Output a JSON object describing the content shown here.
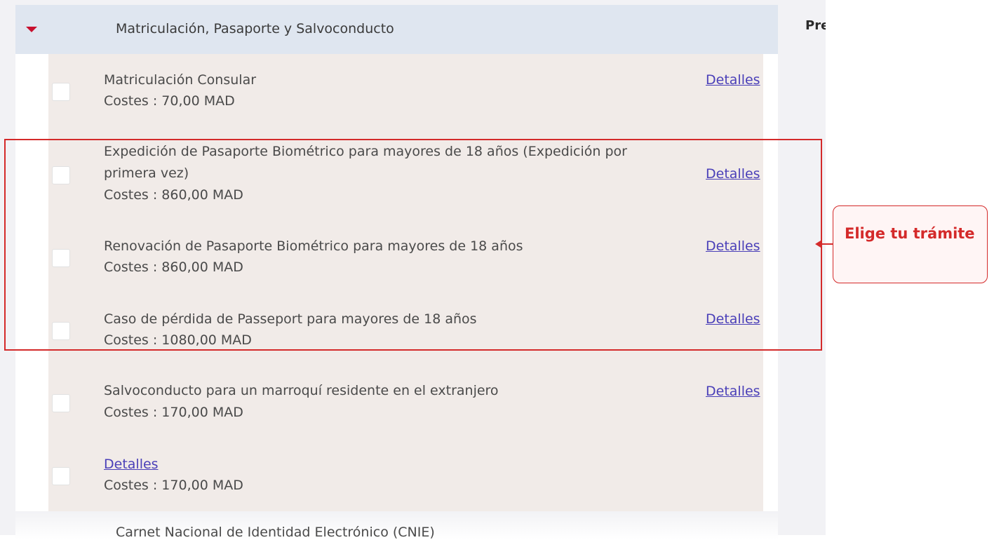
{
  "accordion": {
    "title": "Matriculación, Pasaporte y Salvoconducto",
    "next_title": "Carnet Nacional de Identidad Electrónico (CNIE)"
  },
  "items": [
    {
      "title": "Matriculación Consular",
      "cost": "Costes : 70,00 MAD",
      "details": "Detalles"
    },
    {
      "title": "Expedición de Pasaporte Biométrico para mayores de 18 años (Expedición por primera vez)",
      "cost": "Costes : 860,00 MAD",
      "details": "Detalles"
    },
    {
      "title": "Renovación de Pasaporte Biométrico para mayores de 18 años",
      "cost": "Costes : 860,00 MAD",
      "details": "Detalles"
    },
    {
      "title": "Caso de pérdida de Passeport para mayores de 18 años",
      "cost": "Costes : 1080,00 MAD",
      "details": "Detalles"
    },
    {
      "title": "Salvoconducto para un marroquí residente en el extranjero",
      "cost": "Costes : 170,00 MAD",
      "details": "Detalles"
    },
    {
      "title": "",
      "cost": "Costes : 170,00 MAD",
      "details": "Detalles"
    }
  ],
  "side_text": "Pre",
  "annotation": {
    "callout": "Elige tu trámite",
    "color": "#d42a2a"
  },
  "icons": {
    "caret": "caret-down-icon",
    "arrow": "arrow-left-icon"
  }
}
